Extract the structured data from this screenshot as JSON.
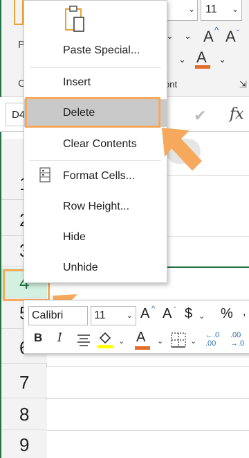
{
  "ribbon": {
    "left_letter": "P",
    "clipboard_letter": "C",
    "font_group_tail": "ont",
    "font_size": "11",
    "increase_font_glyph": "A",
    "decrease_font_glyph": "A",
    "font_color_glyph": "A"
  },
  "formula_bar": {
    "namebox_partial": "D4",
    "fx_label": "fx"
  },
  "context_menu": {
    "items": [
      {
        "label": "Paste Special..."
      },
      {
        "label": "Insert"
      },
      {
        "label": "Delete"
      },
      {
        "label": "Clear Contents"
      },
      {
        "label": "Format Cells..."
      },
      {
        "label": "Row Height..."
      },
      {
        "label": "Hide"
      },
      {
        "label": "Unhide"
      }
    ],
    "highlighted": "Delete"
  },
  "sheet": {
    "rows": [
      "1",
      "2",
      "3",
      "4",
      "5",
      "6",
      "7",
      "8",
      "9"
    ],
    "selected_row": "4"
  },
  "mini_toolbar": {
    "font_name": "Calibri",
    "font_size": "11",
    "grow_font": "A",
    "shrink_font": "A",
    "currency": "$",
    "percent": "%",
    "bold": "B",
    "italic": "I",
    "font_color": "A",
    "increase_decimal": "←.0 .00",
    "decrease_decimal": ".00 →.0"
  },
  "colors": {
    "accent_green": "#217346",
    "annotation_orange": "#f6a85c",
    "highlight_yellow": "#ffff00",
    "font_color_red": "#e46c2b",
    "menu_highlight": "#c9c9c9"
  }
}
